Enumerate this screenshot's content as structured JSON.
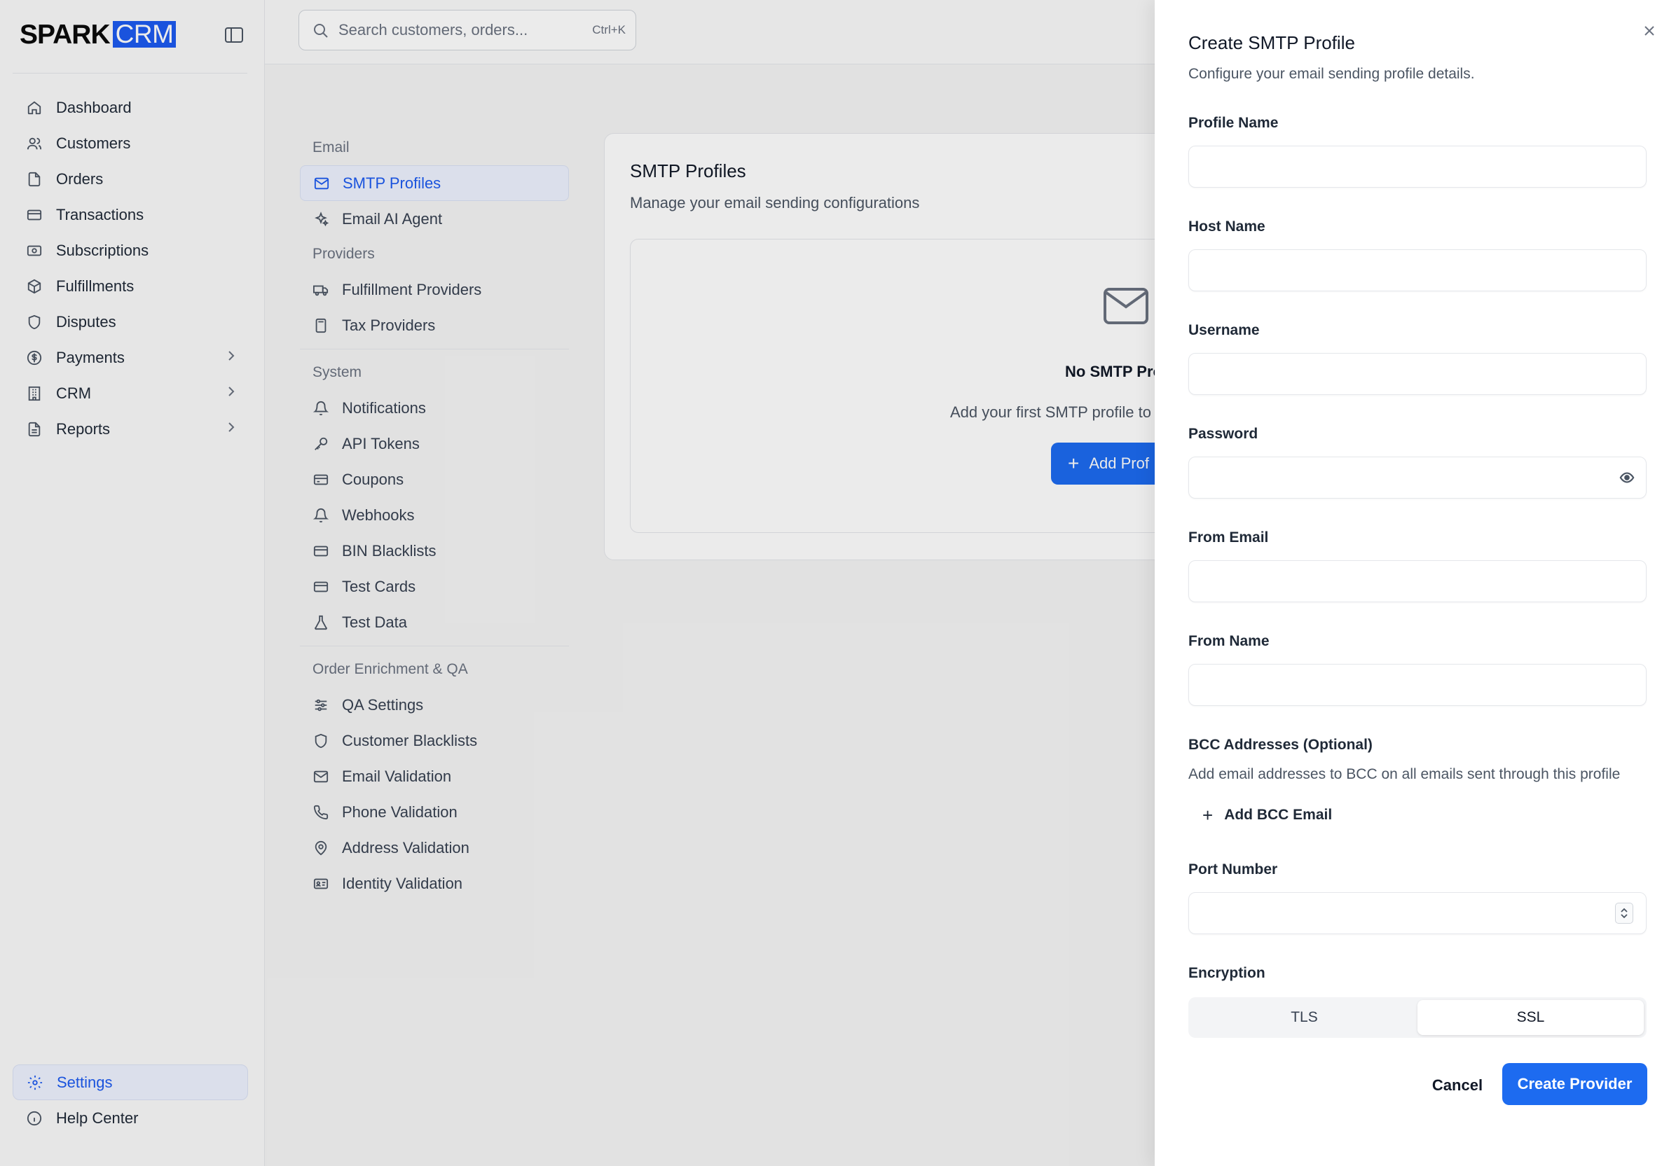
{
  "brand": {
    "spark": "SPARK",
    "crm": "CRM"
  },
  "sidebar": {
    "items": [
      {
        "label": "Dashboard",
        "icon": "home-icon"
      },
      {
        "label": "Customers",
        "icon": "users-icon"
      },
      {
        "label": "Orders",
        "icon": "file-icon"
      },
      {
        "label": "Transactions",
        "icon": "credit-card-icon"
      },
      {
        "label": "Subscriptions",
        "icon": "banknote-icon"
      },
      {
        "label": "Fulfillments",
        "icon": "package-icon"
      },
      {
        "label": "Disputes",
        "icon": "shield-icon"
      },
      {
        "label": "Payments",
        "icon": "dollar-icon",
        "has_children": true
      },
      {
        "label": "CRM",
        "icon": "building-icon",
        "has_children": true
      },
      {
        "label": "Reports",
        "icon": "document-icon",
        "has_children": true
      }
    ],
    "bottom": [
      {
        "label": "Settings",
        "icon": "gear-icon",
        "active": true
      },
      {
        "label": "Help Center",
        "icon": "info-icon"
      }
    ]
  },
  "search": {
    "placeholder": "Search customers, orders...",
    "shortcut": "Ctrl+K"
  },
  "settings_nav": {
    "sections": [
      {
        "heading": "Email",
        "items": [
          {
            "label": "SMTP Profiles",
            "icon": "mail-icon",
            "active": true
          },
          {
            "label": "Email AI Agent",
            "icon": "sparkles-icon"
          }
        ]
      },
      {
        "heading": "Providers",
        "items": [
          {
            "label": "Fulfillment Providers",
            "icon": "truck-icon"
          },
          {
            "label": "Tax Providers",
            "icon": "calculator-icon"
          }
        ]
      },
      {
        "heading": "System",
        "items": [
          {
            "label": "Notifications",
            "icon": "bell-icon"
          },
          {
            "label": "API Tokens",
            "icon": "key-icon"
          },
          {
            "label": "Coupons",
            "icon": "ticket-icon"
          },
          {
            "label": "Webhooks",
            "icon": "bell-icon"
          },
          {
            "label": "BIN Blacklists",
            "icon": "credit-card-icon"
          },
          {
            "label": "Test Cards",
            "icon": "credit-card-icon"
          },
          {
            "label": "Test Data",
            "icon": "flask-icon"
          }
        ]
      },
      {
        "heading": "Order Enrichment & QA",
        "items": [
          {
            "label": "QA Settings",
            "icon": "sliders-icon"
          },
          {
            "label": "Customer Blacklists",
            "icon": "shield-icon"
          },
          {
            "label": "Email Validation",
            "icon": "mail-icon"
          },
          {
            "label": "Phone Validation",
            "icon": "phone-icon"
          },
          {
            "label": "Address Validation",
            "icon": "map-pin-icon"
          },
          {
            "label": "Identity Validation",
            "icon": "id-card-icon"
          }
        ]
      }
    ]
  },
  "main": {
    "title": "SMTP Profiles",
    "description": "Manage your email sending configurations",
    "empty_title": "No SMTP Pro",
    "empty_desc": "Add your first SMTP profile to",
    "add_button": "Add Prof"
  },
  "drawer": {
    "title": "Create SMTP Profile",
    "description": "Configure your email sending profile details.",
    "fields": {
      "profile_name": {
        "label": "Profile Name",
        "value": ""
      },
      "host_name": {
        "label": "Host Name",
        "value": ""
      },
      "username": {
        "label": "Username",
        "value": ""
      },
      "password": {
        "label": "Password",
        "value": ""
      },
      "from_email": {
        "label": "From Email",
        "value": ""
      },
      "from_name": {
        "label": "From Name",
        "value": ""
      },
      "port_number": {
        "label": "Port Number",
        "value": ""
      }
    },
    "bcc": {
      "label": "BCC Addresses (Optional)",
      "help": "Add email addresses to BCC on all emails sent through this profile",
      "add_label": "Add BCC Email"
    },
    "encryption": {
      "label": "Encryption",
      "options": [
        "TLS",
        "SSL"
      ],
      "selected": "SSL"
    },
    "cancel_label": "Cancel",
    "create_label": "Create Provider"
  },
  "colors": {
    "accent": "#1d6bf0",
    "brand_blue": "#1d5bf0"
  }
}
